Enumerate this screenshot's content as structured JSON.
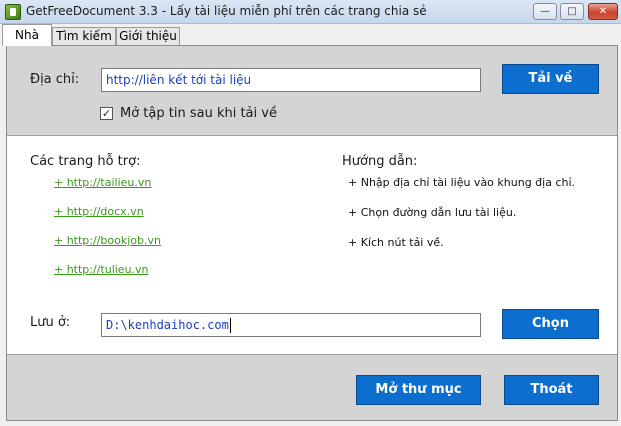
{
  "window": {
    "title": "GetFreeDocument 3.3 - Lấy tài liệu miễn phí trên các trang chia sẻ",
    "min_glyph": "—",
    "max_glyph": "□",
    "close_glyph": "✕"
  },
  "tabs": [
    {
      "label": "Nhà",
      "active": true
    },
    {
      "label": "Tìm kiếm",
      "active": false
    },
    {
      "label": "Giới thiệu",
      "active": false
    }
  ],
  "address": {
    "label": "Địa chỉ:",
    "value": "http://liên kết tới tài liệu",
    "download_button": "Tải về"
  },
  "open_after": {
    "checked": true,
    "check_glyph": "✓",
    "label": "Mở tập tin sau khi tải về"
  },
  "supported": {
    "heading": "Các trang hỗ trợ:",
    "links": [
      "+ http://tailieu.vn",
      "+ http://docx.vn",
      "+ http://bookjob.vn",
      "+ http://tulieu.vn"
    ]
  },
  "guide": {
    "heading": "Hướng dẫn:",
    "steps": [
      "+ Nhập địa chỉ tài liệu vào khung địa chỉ.",
      "+ Chọn đường dẫn lưu tài liệu.",
      "+ Kích nút tải về."
    ]
  },
  "save": {
    "label": "Lưu ở:",
    "value": "D:\\kenhdaihoc.com",
    "choose_button": "Chọn"
  },
  "footer": {
    "open_folder_button": "Mở thư mục",
    "exit_button": "Thoát"
  },
  "colors": {
    "button_bg": "#0c6fd0",
    "link": "#3a9a1a",
    "input_text": "#1a3fbf"
  }
}
